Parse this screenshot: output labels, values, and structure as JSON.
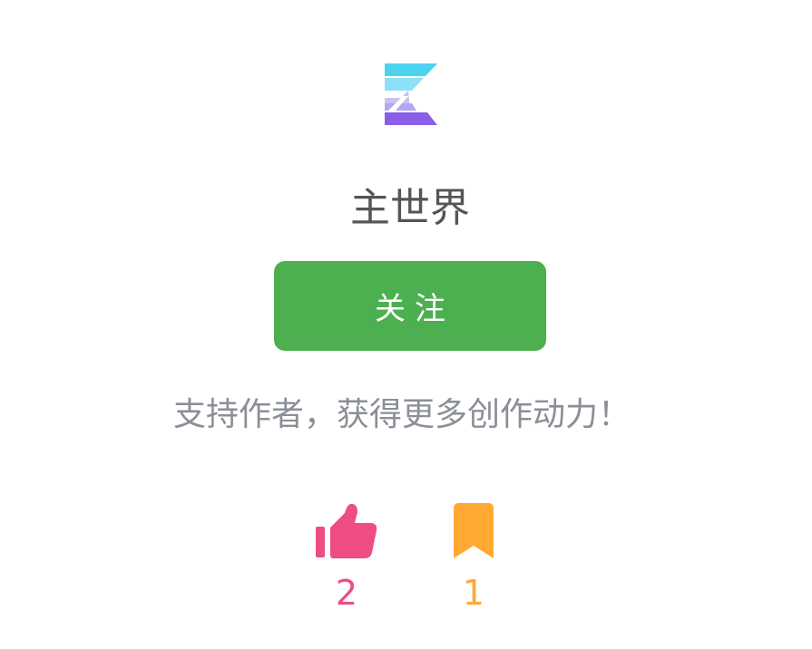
{
  "logo": {
    "icon": "stacked-e-logo-icon",
    "colors": [
      "#4dd3f0",
      "#8de1f6",
      "#b3a6f2",
      "#8a5ee6"
    ]
  },
  "author": {
    "name": "主世界"
  },
  "follow_button": {
    "label": "关注",
    "color": "#4caf50"
  },
  "tagline": "支持作者，获得更多创作动力！",
  "actions": {
    "like": {
      "icon": "thumbs-up-icon",
      "count": "2",
      "color": "#ee4d83"
    },
    "favorite": {
      "icon": "bookmark-icon",
      "count": "1",
      "color": "#ffa933"
    }
  }
}
